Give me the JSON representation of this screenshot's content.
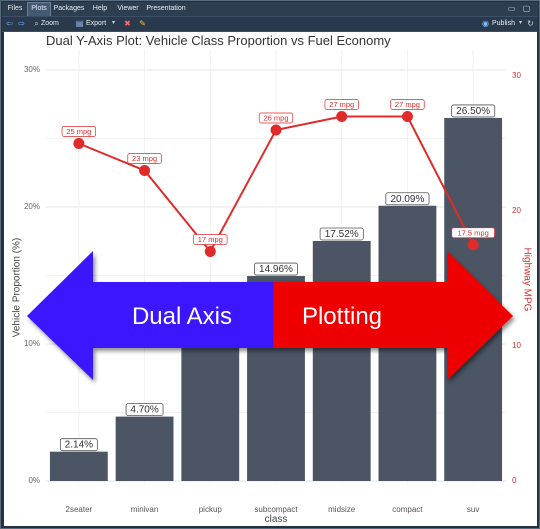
{
  "tabs": [
    "Files",
    "Plots",
    "Packages",
    "Help",
    "Viewer",
    "Presentation"
  ],
  "active_tab": "Plots",
  "toolbar": {
    "zoom_label": "Zoom",
    "export_label": "Export",
    "publish_label": "Publish"
  },
  "chart_data": {
    "type": "bar",
    "title": "Dual Y-Axis Plot: Vehicle Class Proportion vs Fuel Economy",
    "xlabel": "class",
    "ylabel": "Vehicle Proportion (%)",
    "ylabel_right": "Highway MPG",
    "categories": [
      "2seater",
      "minivan",
      "pickup",
      "subcompact",
      "midsize",
      "compact",
      "suv"
    ],
    "series": [
      {
        "name": "proportion",
        "type": "bar",
        "values": [
          2.14,
          4.7,
          14.53,
          14.96,
          17.52,
          20.09,
          26.5
        ],
        "labels": [
          "2.14%",
          "4.70%",
          "",
          "14.96%",
          "17.52%",
          "20.09%",
          "26.50%"
        ]
      },
      {
        "name": "hwy mpg",
        "type": "line",
        "values": [
          25,
          23,
          17,
          26,
          27,
          27,
          17.5
        ],
        "labels": [
          "25 mpg",
          "23 mpg",
          "17 mpg",
          "26 mpg",
          "27 mpg",
          "27 mpg",
          "17.5 mpg"
        ]
      }
    ],
    "ylim": [
      0,
      30
    ],
    "yticks": [
      "0%",
      "10%",
      "20%",
      "30%"
    ],
    "ylim_right": [
      0,
      30
    ],
    "yticks_right": [
      "0",
      "10",
      "20",
      "30"
    ],
    "grid": true,
    "colors": {
      "bar": "#4b5563",
      "line": "#e02b2b"
    }
  },
  "overlay": {
    "left_text": "Dual Axis",
    "right_text": "Plotting",
    "left_color": "#3a12ff",
    "right_color": "#ee0000"
  }
}
